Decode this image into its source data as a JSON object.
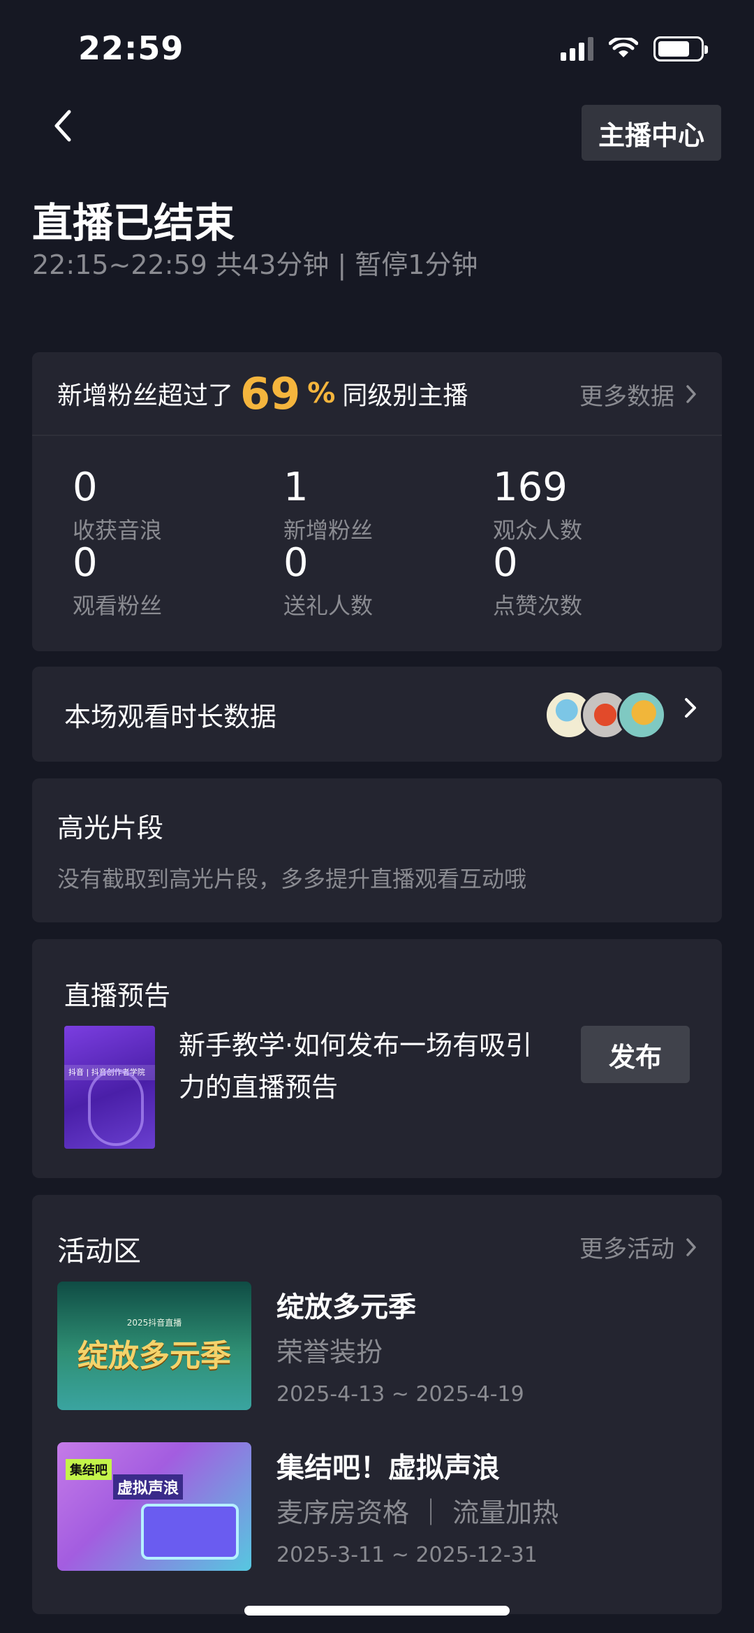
{
  "status_bar": {
    "time": "22:59"
  },
  "header": {
    "host_center_label": "主播中心",
    "title": "直播已结束",
    "subtitle": "22:15~22:59 共43分钟 | 暂停1分钟"
  },
  "stats": {
    "headline_prefix": "新增粉丝超过了",
    "headline_percent": "69",
    "headline_percent_sign": "%",
    "headline_suffix": "同级别主播",
    "more_label": "更多数据",
    "items": [
      {
        "value": "0",
        "label": "收获音浪"
      },
      {
        "value": "1",
        "label": "新增粉丝"
      },
      {
        "value": "169",
        "label": "观众人数"
      },
      {
        "value": "0",
        "label": "观看粉丝"
      },
      {
        "value": "0",
        "label": "送礼人数"
      },
      {
        "value": "0",
        "label": "点赞次数"
      }
    ]
  },
  "watch_duration": {
    "title": "本场观看时长数据"
  },
  "highlight": {
    "title": "高光片段",
    "description": "没有截取到高光片段，多多提升直播观看互动哦"
  },
  "preview": {
    "title": "直播预告",
    "thumb_text": "抖音 | 抖音创作者学院",
    "text": "新手教学·如何发布一场有吸引力的直播预告",
    "publish_label": "发布"
  },
  "activity": {
    "title": "活动区",
    "more_label": "更多活动",
    "items": [
      {
        "name": "绽放多元季",
        "tag": "荣誉装扮",
        "date": "2025-4-13 ~ 2025-4-19",
        "thumb_title": "绽放多元季",
        "thumb_sub": "2025抖音直播"
      },
      {
        "name": "集结吧！虚拟声浪",
        "tag": "麦序房资格 ｜ 流量加热",
        "date": "2025-3-11 ~ 2025-12-31",
        "thumb_title": "虚拟声浪",
        "thumb_sub": "集结吧"
      }
    ]
  },
  "colors": {
    "background": "#161823",
    "card": "#242530",
    "accent_gold": "#f5b53d",
    "muted_text": "#8a8b91"
  }
}
